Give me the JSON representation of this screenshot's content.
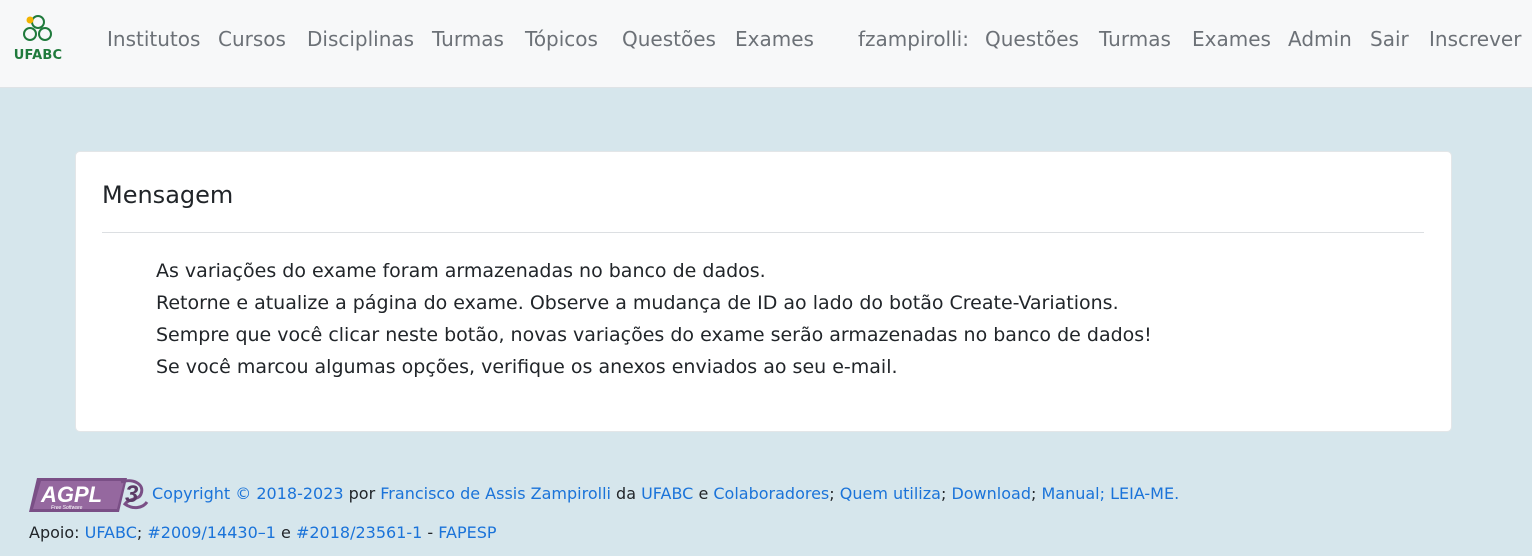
{
  "brand": {
    "logo_text": "UFABC"
  },
  "nav": {
    "links": [
      "Institutos",
      "Cursos",
      "Disciplinas",
      "Turmas",
      "Tópicos",
      "Questões",
      "Exames"
    ],
    "user": "fzampirolli:",
    "user_links": [
      "Questões",
      "Turmas",
      "Exames",
      "Admin",
      "Sair",
      "Inscrever"
    ]
  },
  "card": {
    "title": "Mensagem",
    "lines": [
      "As variações do exame foram armazenadas no banco de dados.",
      "Retorne e atualize a página do exame. Observe a mudança de ID ao lado do botão Create-Variations.",
      "Sempre que você clicar neste botão, novas variações do exame serão armazenadas no banco de dados!",
      "Se você marcou algumas opções, verifique os anexos enviados ao seu e-mail."
    ]
  },
  "footer": {
    "agpl_text": "AGPL",
    "agpl_number": "3",
    "agpl_sub": "Free Software",
    "copyright": "Copyright © 2018-2023",
    "por": " por ",
    "author": "Francisco de Assis Zampirolli",
    "da": " da ",
    "ufabc": "UFABC",
    "e": " e ",
    "colaboradores": "Colaboradores",
    "sep1": "; ",
    "quem": "Quem utiliza",
    "sep2": "; ",
    "download": "Download",
    "sep3": "; ",
    "manual": "Manual; LEIA-ME.",
    "apoio": "Apoio: ",
    "apoio_ufabc": "UFABC",
    "sep4": "; ",
    "grant1": "#2009/14430–1",
    "e2": " e ",
    "grant2": "#2018/23561-1",
    "dash": " - ",
    "fapesp": "FAPESP"
  },
  "colors": {
    "link": "#1a73d9",
    "nav_text": "#6c7177",
    "page_bg": "#d6e6ec",
    "logo_green": "#1f7a3c",
    "logo_yellow": "#f2b300"
  }
}
